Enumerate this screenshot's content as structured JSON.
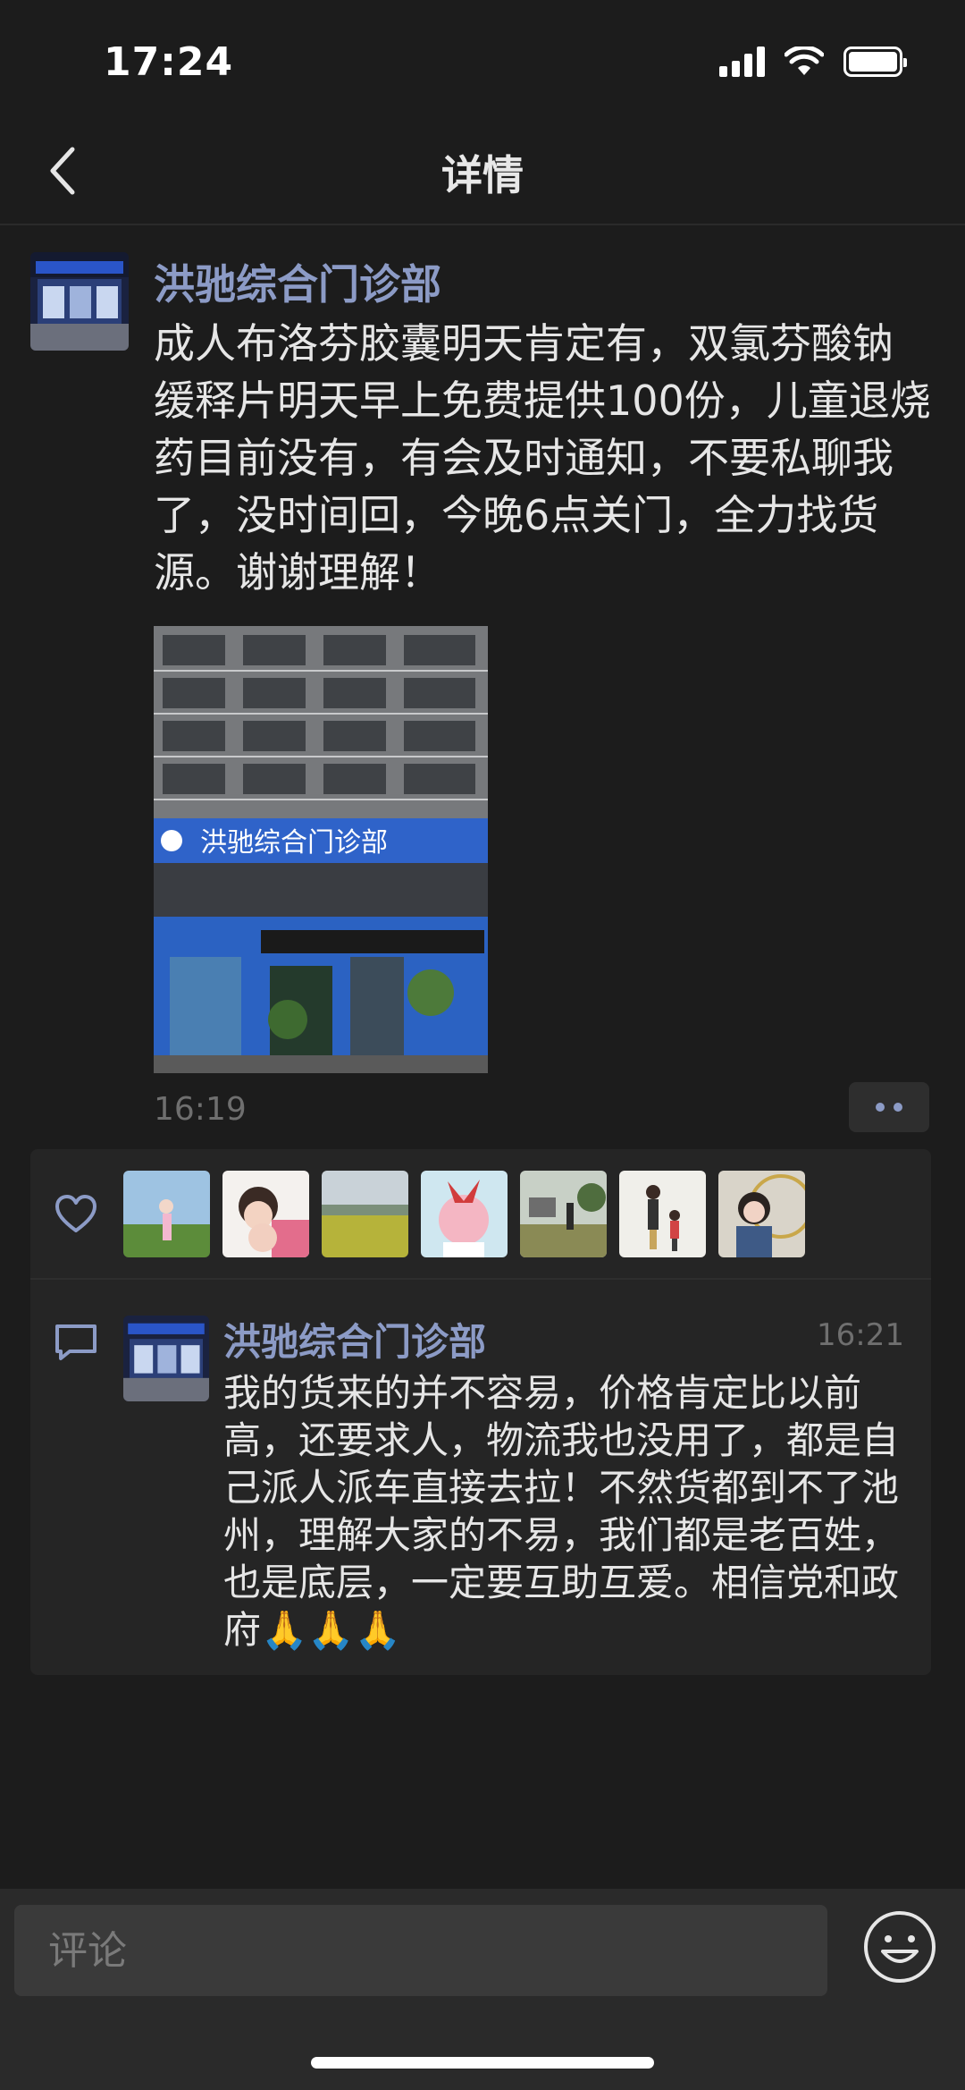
{
  "status_bar": {
    "time": "17:24"
  },
  "nav": {
    "title": "详情",
    "back_icon": "chevron-left-icon"
  },
  "post": {
    "author": "洪驰综合门诊部",
    "text": "成人布洛芬胶囊明天肯定有，双氯芬酸钠缓释片明天早上免费提供100份，儿童退烧药目前没有，有会及时通知，不要私聊我了，没时间回，今晚6点关门，全力找货源。谢谢理解！",
    "image_sign_text": "洪驰综合门诊部",
    "time": "16:19"
  },
  "likes": {
    "icon": "heart-icon",
    "avatar_count": 7
  },
  "comment": {
    "icon": "comment-icon",
    "author": "洪驰综合门诊部",
    "time": "16:21",
    "text": "我的货来的并不容易，价格肯定比以前高，还要求人，物流我也没用了，都是自己派人派车直接去拉！不然货都到不了池州，理解大家的不易，我们都是老百姓，也是底层，一定要互助互爱。相信党和政府",
    "emoji": "🙏🙏🙏"
  },
  "composer": {
    "placeholder": "评论",
    "emoji_icon": "smiley-icon"
  },
  "colors": {
    "background": "#1c1c1c",
    "name_blue": "#8c9bc6",
    "panel": "#252525"
  }
}
